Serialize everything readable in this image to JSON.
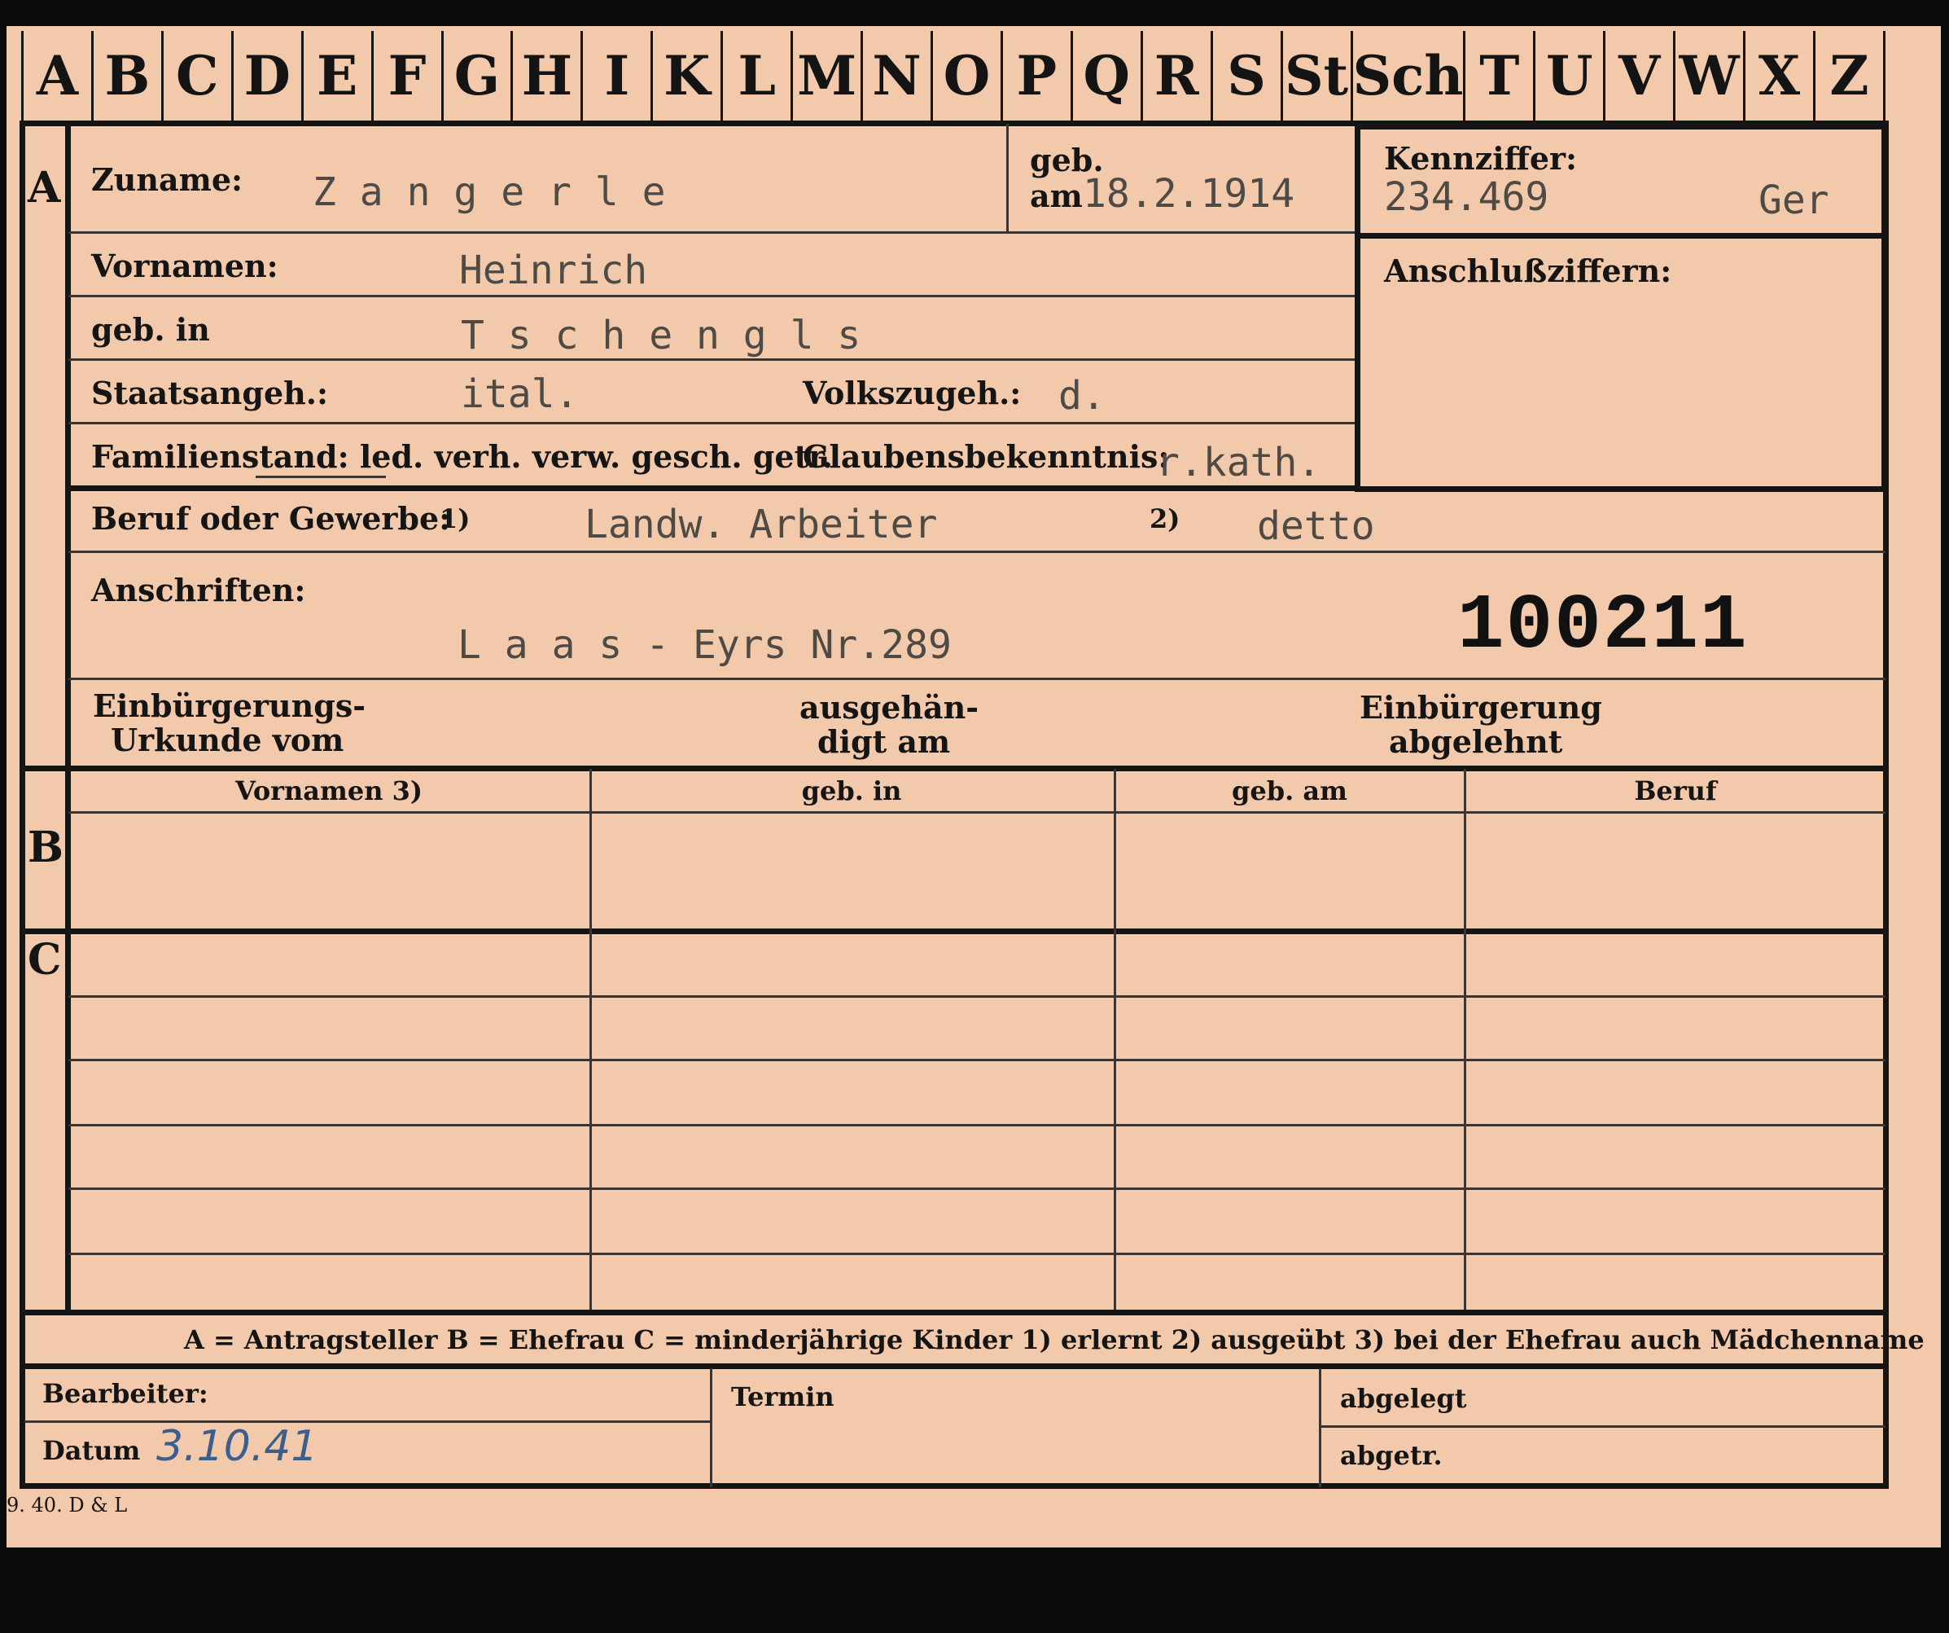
{
  "tabs": [
    "A",
    "B",
    "C",
    "D",
    "E",
    "F",
    "G",
    "H",
    "I",
    "K",
    "L",
    "M",
    "N",
    "O",
    "P",
    "Q",
    "R",
    "S",
    "St",
    "Sch",
    "T",
    "U",
    "V",
    "W",
    "X",
    "Z"
  ],
  "sections": {
    "a": "A",
    "b": "B",
    "c": "C"
  },
  "person": {
    "surname_label": "Zuname:",
    "surname": "Z a n g e r l e",
    "born_label_1": "geb.",
    "born_label_2": "am",
    "born_date": "18.2.1914",
    "firstname_label": "Vornamen:",
    "firstname": "Heinrich",
    "birthplace_label": "geb. in",
    "birthplace": "T s c h e n g l s",
    "citizenship_label": "Staatsangeh.:",
    "citizenship": "ital.",
    "ethnicity_label": "Volkszugeh.:",
    "ethnicity": "d.",
    "marital_label": "Familienstand: led. verh. verw. gesch. getr.",
    "religion_label": "Glaubensbekenntnis:",
    "religion": "r.kath.",
    "occupation_label": "Beruf oder Gewerbe:",
    "occupation_mark_1": "1)",
    "occupation_1": "Landw. Arbeiter",
    "occupation_mark_2": "2)",
    "occupation_2": "detto",
    "address_label": "Anschriften:",
    "address": "L a a s - Eyrs Nr.289",
    "stamp_number": "100211"
  },
  "id_box": {
    "label": "Kennziffer:",
    "number": "234.469",
    "code": "Ger",
    "sub_label": "Anschlußziffern:"
  },
  "naturalization": {
    "cert_label_1": "Einbürgerungs-",
    "cert_label_2": "Urkunde vom",
    "handed_label_1": "ausgehän-",
    "handed_label_2": "digt am",
    "refused_label_1": "Einbürgerung",
    "refused_label_2": "abgelehnt"
  },
  "spouse_columns": [
    "Vornamen 3)",
    "geb. in",
    "geb. am",
    "Beruf"
  ],
  "legend": "A = Antragsteller    B = Ehefrau    C = minderjährige Kinder    1) erlernt    2) ausgeübt    3) bei der Ehefrau auch Mädchenname",
  "footer": {
    "clerk_label": "Bearbeiter:",
    "date_label": "Datum",
    "date_value": "3.10.41",
    "term_label": "Termin",
    "filed_label": "abgelegt",
    "copied_label": "abgetr."
  },
  "print_code": "9. 40. D & L"
}
